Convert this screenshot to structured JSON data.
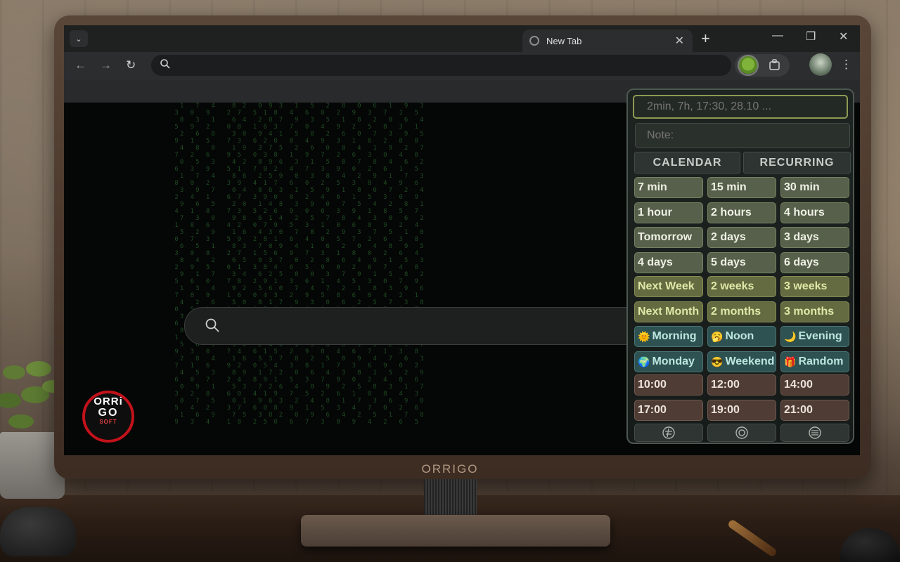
{
  "monitor": {
    "brand": "ORRIGO"
  },
  "browser": {
    "tab": {
      "title": "New Tab"
    },
    "window_controls": [
      "—",
      "❐",
      "✕"
    ],
    "omnibox": {
      "value": ""
    }
  },
  "page": {
    "search": {
      "value": ""
    },
    "logo": {
      "line1": "ORRi",
      "line2": "GO",
      "line3": "SOFT"
    }
  },
  "popup": {
    "time_input": {
      "placeholder": "2min, 7h, 17:30, 28.10 ..."
    },
    "note_input": {
      "placeholder": "Note:"
    },
    "modes": [
      "CALENDAR",
      "RECURRING"
    ],
    "quick_buttons": [
      {
        "label": "7 min",
        "style": "green"
      },
      {
        "label": "15 min",
        "style": "green"
      },
      {
        "label": "30 min",
        "style": "green"
      },
      {
        "label": "1 hour",
        "style": "green"
      },
      {
        "label": "2 hours",
        "style": "green"
      },
      {
        "label": "4 hours",
        "style": "green"
      },
      {
        "label": "Tomorrow",
        "style": "green"
      },
      {
        "label": "2 days",
        "style": "green"
      },
      {
        "label": "3 days",
        "style": "green"
      },
      {
        "label": "4 days",
        "style": "green"
      },
      {
        "label": "5 days",
        "style": "green"
      },
      {
        "label": "6 days",
        "style": "green"
      },
      {
        "label": "Next Week",
        "style": "olive"
      },
      {
        "label": "2 weeks",
        "style": "olive"
      },
      {
        "label": "3 weeks",
        "style": "olive"
      },
      {
        "label": "Next Month",
        "style": "olive"
      },
      {
        "label": "2 months",
        "style": "olive"
      },
      {
        "label": "3 months",
        "style": "olive"
      },
      {
        "label": "Morning",
        "style": "teal",
        "emoji": "🌞"
      },
      {
        "label": "Noon",
        "style": "teal",
        "emoji": "🥱"
      },
      {
        "label": "Evening",
        "style": "teal",
        "emoji": "🌙"
      },
      {
        "label": "Monday",
        "style": "teal",
        "emoji": "🌍"
      },
      {
        "label": "Weekend",
        "style": "teal",
        "emoji": "😎"
      },
      {
        "label": "Random",
        "style": "teal",
        "emoji": "🎁"
      },
      {
        "label": "10:00",
        "style": "brown"
      },
      {
        "label": "12:00",
        "style": "brown"
      },
      {
        "label": "14:00",
        "style": "brown"
      },
      {
        "label": "17:00",
        "style": "brown"
      },
      {
        "label": "19:00",
        "style": "brown"
      },
      {
        "label": "21:00",
        "style": "brown"
      }
    ],
    "bottom_icons": [
      "settings-icon",
      "theme-icon",
      "list-icon"
    ]
  }
}
